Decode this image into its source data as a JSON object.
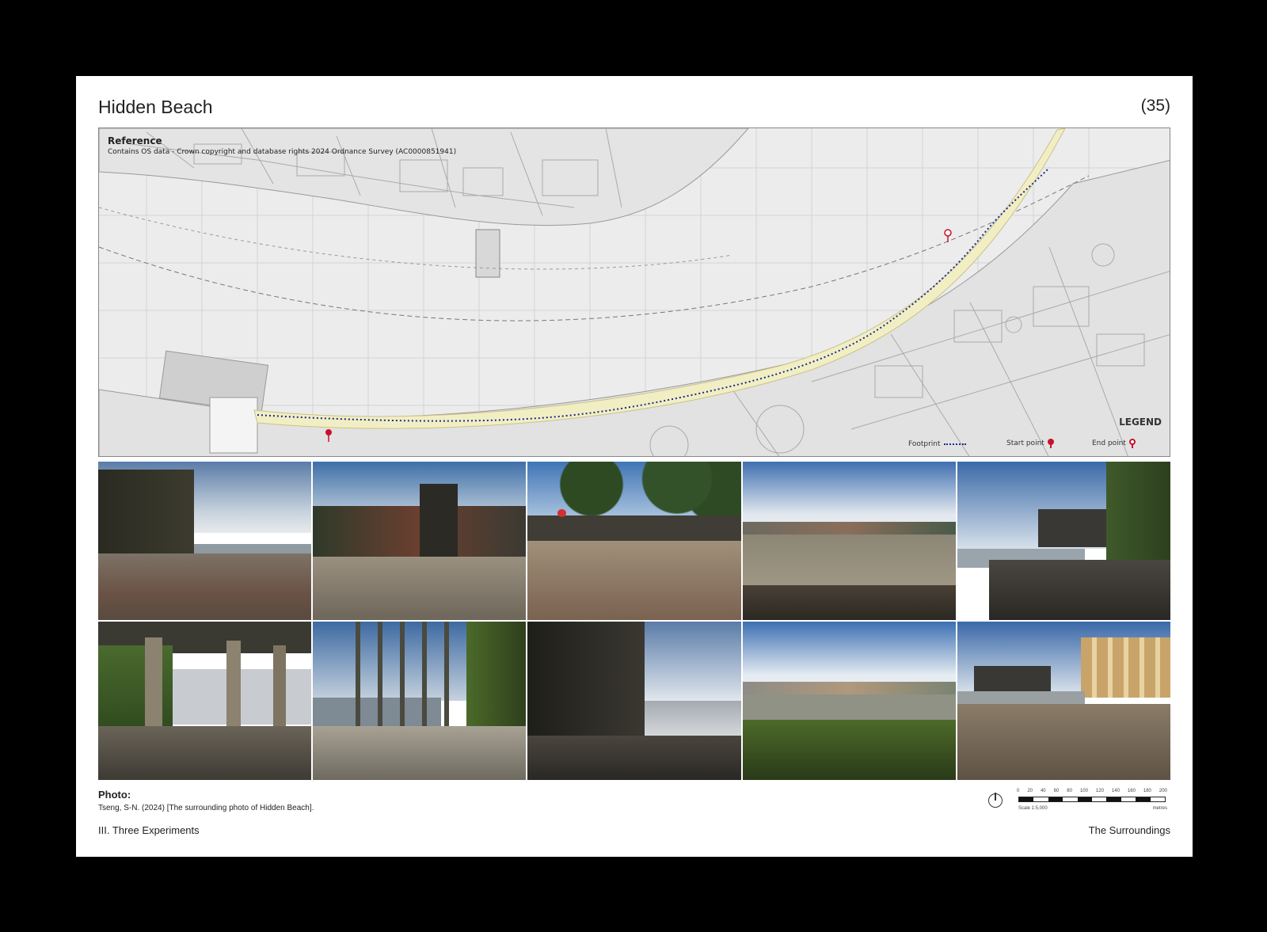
{
  "header": {
    "title": "Hidden Beach",
    "page_number": "(35)"
  },
  "map": {
    "reference_heading": "Reference",
    "reference_text": "Contains OS data - Crown copyright and database rights 2024 Ordnance Survey (AC0000851941)",
    "legend": {
      "heading": "LEGEND",
      "footprint": "Footprint",
      "start_point": "Start point",
      "end_point": "End point"
    },
    "colors": {
      "footpath": "#1a2a8c",
      "beach": "#f2eec4",
      "pin": "#c8102e"
    }
  },
  "photos": [
    {
      "scene": "foreshore-wall-shard"
    },
    {
      "scene": "timber-pier-gravel"
    },
    {
      "scene": "wall-trees-gravel"
    },
    {
      "scene": "river-view-stones"
    },
    {
      "scene": "jetty-mossy-wall"
    },
    {
      "scene": "under-pier-columns"
    },
    {
      "scene": "steel-frame-chains"
    },
    {
      "scene": "dark-pier-shard-view"
    },
    {
      "scene": "river-seaweed-bank"
    },
    {
      "scene": "pier-buildings-beach"
    }
  ],
  "caption": {
    "heading": "Photo:",
    "text": "Tseng, S-N. (2024) [The surrounding photo of Hidden Beach]."
  },
  "scale": {
    "ticks": [
      "0",
      "20",
      "40",
      "60",
      "80",
      "100",
      "120",
      "140",
      "160",
      "180",
      "200"
    ],
    "label": "Scale 1:5,000",
    "unit": "metres"
  },
  "footer": {
    "left": "III. Three Experiments",
    "right": "The Surroundings"
  }
}
